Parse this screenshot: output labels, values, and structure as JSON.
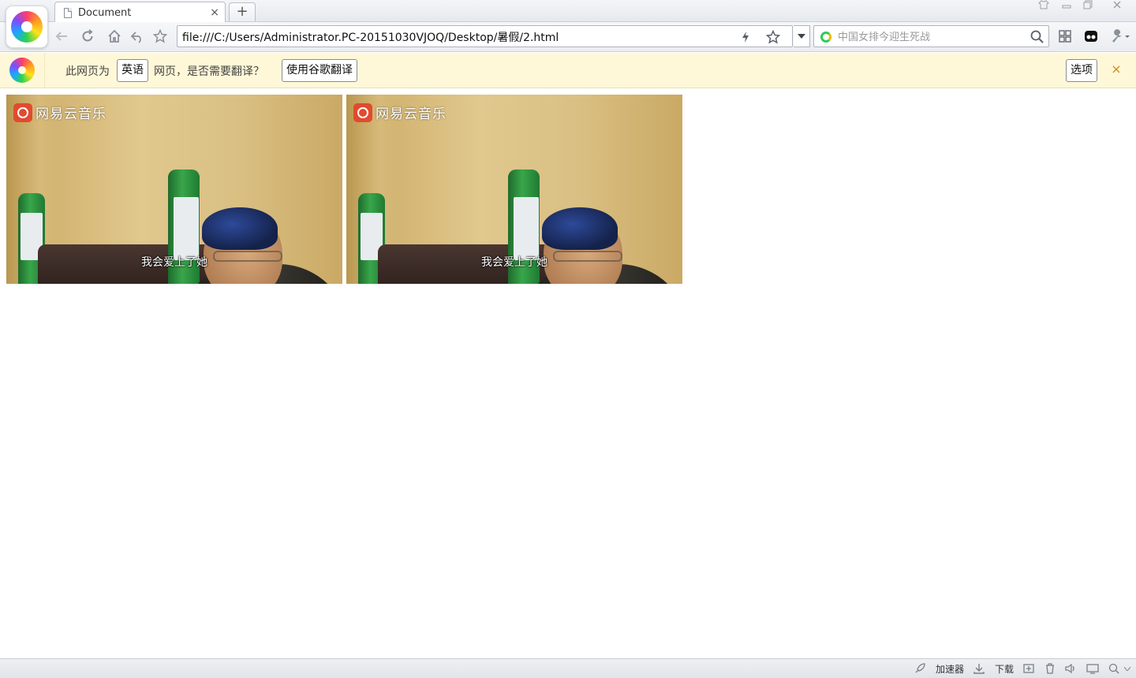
{
  "browser": {
    "tab": {
      "title": "Document",
      "close_glyph": "×"
    },
    "new_tab_glyph": "+",
    "address": {
      "url": "file:///C:/Users/Administrator.PC-20151030VJOQ/Desktop/暑假/2.html"
    },
    "search": {
      "placeholder": "中国女排今迎生死战"
    }
  },
  "translate_bar": {
    "prefix": "此网页为",
    "language": "英语",
    "question": "网页，是否需要翻译？",
    "translate_button": "使用谷歌翻译",
    "options_button": "选项",
    "close_glyph": "×"
  },
  "content": {
    "frames": [
      {
        "brand": "网易云音乐",
        "subtitle": "我会爱上了她"
      },
      {
        "brand": "网易云音乐",
        "subtitle": "我会爱上了她"
      }
    ]
  },
  "statusbar": {
    "accelerator": "加速器",
    "download": "下载"
  },
  "colors": {
    "translate_bar_bg": "#fff8d8",
    "brand_red": "#e24a2e",
    "search_logo_green": "#2ecc5a"
  }
}
